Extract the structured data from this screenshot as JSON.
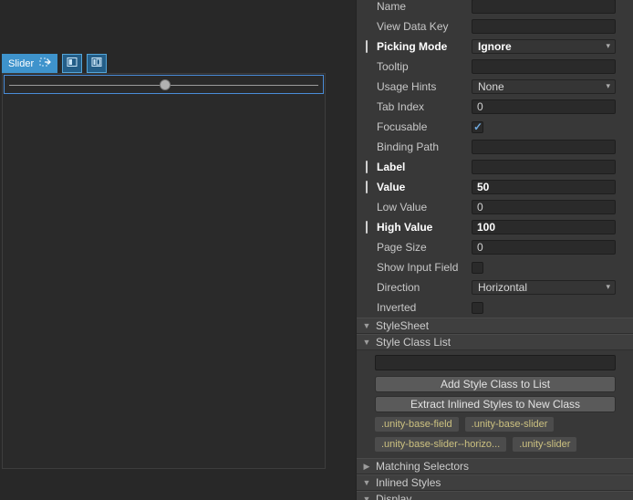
{
  "colors": {
    "selection_blue": "#3E93CC",
    "modified_bar": "#CFCFCF",
    "pill_text": "#CCC180"
  },
  "canvas": {
    "selected_element": "Slider",
    "slider_preview": {
      "value": 50,
      "low_value": 0,
      "high_value": 100
    }
  },
  "inspector": {
    "fields": [
      {
        "label": "Name",
        "type": "text",
        "value": "",
        "modified": false
      },
      {
        "label": "View Data Key",
        "type": "text",
        "value": "",
        "modified": false
      },
      {
        "label": "Picking Mode",
        "type": "dropdown",
        "value": "Ignore",
        "modified": true
      },
      {
        "label": "Tooltip",
        "type": "text",
        "value": "",
        "modified": false
      },
      {
        "label": "Usage Hints",
        "type": "dropdown",
        "value": "None",
        "modified": false
      },
      {
        "label": "Tab Index",
        "type": "text",
        "value": "0",
        "modified": false
      },
      {
        "label": "Focusable",
        "type": "checkbox",
        "checked": true,
        "modified": false
      },
      {
        "label": "Binding Path",
        "type": "text",
        "value": "",
        "modified": false
      },
      {
        "label": "Label",
        "type": "text",
        "value": "",
        "modified": true
      },
      {
        "label": "Value",
        "type": "text",
        "value": "50",
        "modified": true
      },
      {
        "label": "Low Value",
        "type": "text",
        "value": "0",
        "modified": false
      },
      {
        "label": "High Value",
        "type": "text",
        "value": "100",
        "modified": true
      },
      {
        "label": "Page Size",
        "type": "text",
        "value": "0",
        "modified": false
      },
      {
        "label": "Show Input Field",
        "type": "checkbox",
        "checked": false,
        "modified": false
      },
      {
        "label": "Direction",
        "type": "dropdown",
        "value": "Horizontal",
        "modified": false
      },
      {
        "label": "Inverted",
        "type": "checkbox",
        "checked": false,
        "modified": false
      }
    ],
    "sections": {
      "stylesheet": {
        "label": "StyleSheet",
        "expanded": true
      },
      "style_class_list": {
        "label": "Style Class List",
        "expanded": true,
        "input_value": "",
        "add_button": "Add Style Class to List",
        "extract_button": "Extract Inlined Styles to New Class",
        "pills": [
          ".unity-base-field",
          ".unity-base-slider",
          ".unity-base-slider--horizo...",
          ".unity-slider"
        ]
      },
      "matching_selectors": {
        "label": "Matching Selectors",
        "expanded": false
      },
      "inlined_styles": {
        "label": "Inlined Styles",
        "expanded": true
      },
      "display": {
        "label": "Display",
        "expanded": true
      }
    }
  }
}
